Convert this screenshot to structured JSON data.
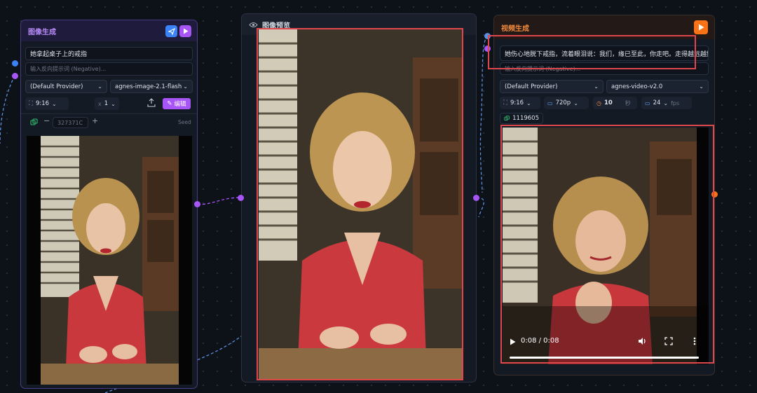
{
  "image_gen_node": {
    "title": "图像生成",
    "prompt": "她拿起桌子上的戒指",
    "negative_placeholder": "输入反向提示词 (Negative)...",
    "provider": "(Default Provider)",
    "model": "agnes-image-2.1-flash",
    "ratio": "9:16",
    "count": "1",
    "count_prefix": "x",
    "edit_label": "编辑",
    "seed_value": "327371C",
    "seed_label": "Seed",
    "minus": "−",
    "plus": "+"
  },
  "preview_node": {
    "title": "图像预览"
  },
  "video_gen_node": {
    "title": "视频生成",
    "prompt": "她伤心地脱下戒指，流着眼泪说：我们，缘已至此，你走吧。走得越远越好",
    "negative_placeholder": "输入反向提示词 (Negative)...",
    "provider": "(Default Provider)",
    "model": "agnes-video-v2.0",
    "ratio": "9:16",
    "resolution": "720p",
    "duration": "10",
    "duration_unit": "秒",
    "fps": "24",
    "fps_unit": "fps",
    "seed_value": "1119605",
    "player": {
      "time": "0:08 / 0:08",
      "progress": 1.0
    }
  },
  "colors": {
    "purple_accent": "#a855f7",
    "blue_accent": "#3b82f6",
    "orange_accent": "#f97316",
    "highlight_red": "#e0474c"
  }
}
